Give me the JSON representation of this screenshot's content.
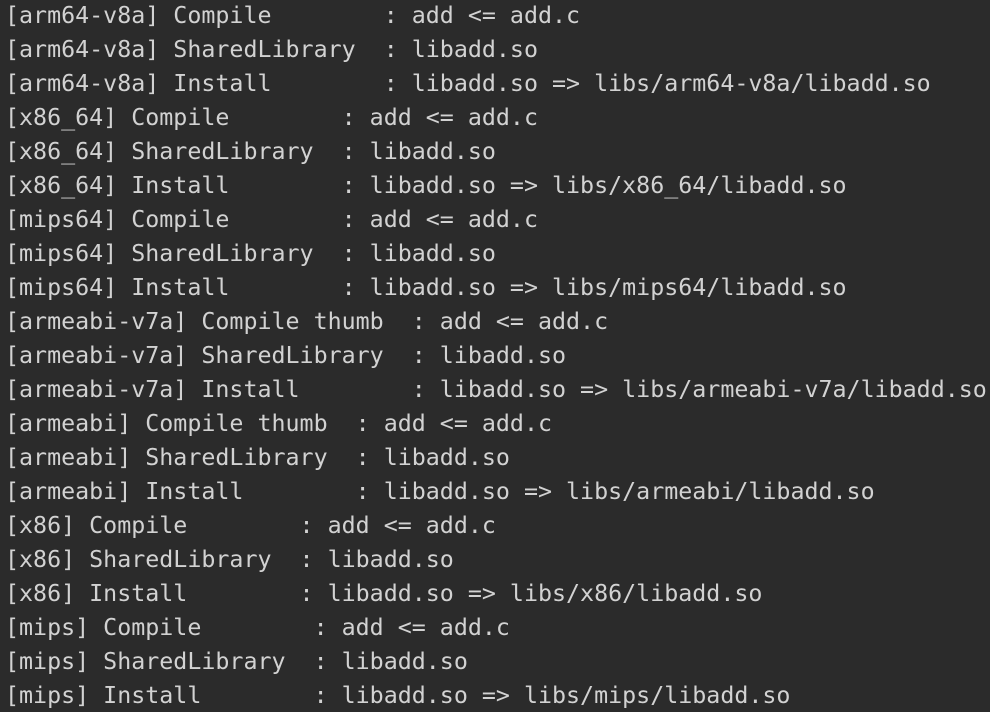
{
  "terminal": {
    "lines": [
      "[arm64-v8a] Compile        : add <= add.c",
      "[arm64-v8a] SharedLibrary  : libadd.so",
      "[arm64-v8a] Install        : libadd.so => libs/arm64-v8a/libadd.so",
      "[x86_64] Compile        : add <= add.c",
      "[x86_64] SharedLibrary  : libadd.so",
      "[x86_64] Install        : libadd.so => libs/x86_64/libadd.so",
      "[mips64] Compile        : add <= add.c",
      "[mips64] SharedLibrary  : libadd.so",
      "[mips64] Install        : libadd.so => libs/mips64/libadd.so",
      "[armeabi-v7a] Compile thumb  : add <= add.c",
      "[armeabi-v7a] SharedLibrary  : libadd.so",
      "[armeabi-v7a] Install        : libadd.so => libs/armeabi-v7a/libadd.so",
      "[armeabi] Compile thumb  : add <= add.c",
      "[armeabi] SharedLibrary  : libadd.so",
      "[armeabi] Install        : libadd.so => libs/armeabi/libadd.so",
      "[x86] Compile        : add <= add.c",
      "[x86] SharedLibrary  : libadd.so",
      "[x86] Install        : libadd.so => libs/x86/libadd.so",
      "[mips] Compile        : add <= add.c",
      "[mips] SharedLibrary  : libadd.so",
      "[mips] Install        : libadd.so => libs/mips/libadd.so"
    ]
  },
  "colors": {
    "background": "#2b2b2b",
    "text": "#d2d2d2"
  }
}
